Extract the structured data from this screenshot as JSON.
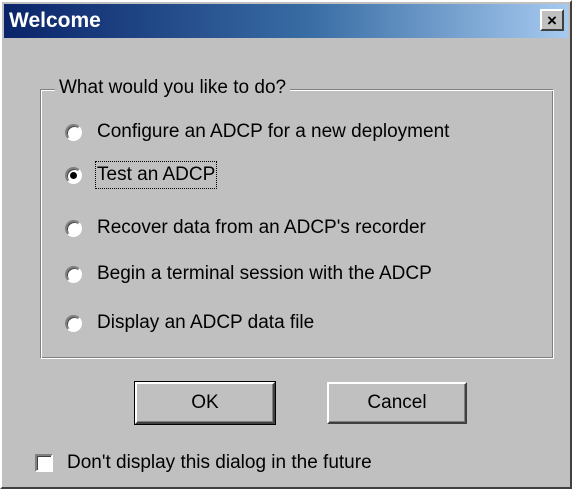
{
  "window": {
    "title": "Welcome",
    "close_glyph": "×"
  },
  "group": {
    "label": "What would you like to do?"
  },
  "options": [
    {
      "label": "Configure an ADCP for a new deployment",
      "selected": false
    },
    {
      "label": "Test an ADCP",
      "selected": true
    },
    {
      "label": "Recover data from an ADCP's recorder",
      "selected": false
    },
    {
      "label": "Begin a terminal session with the ADCP",
      "selected": false
    },
    {
      "label": "Display an ADCP data file",
      "selected": false
    }
  ],
  "buttons": {
    "ok": "OK",
    "cancel": "Cancel"
  },
  "checkbox": {
    "label": "Don't display this dialog in the future",
    "checked": false
  },
  "colors": {
    "face": "#c0c0c0",
    "title_start": "#0a246a",
    "title_end": "#a6caf0"
  }
}
